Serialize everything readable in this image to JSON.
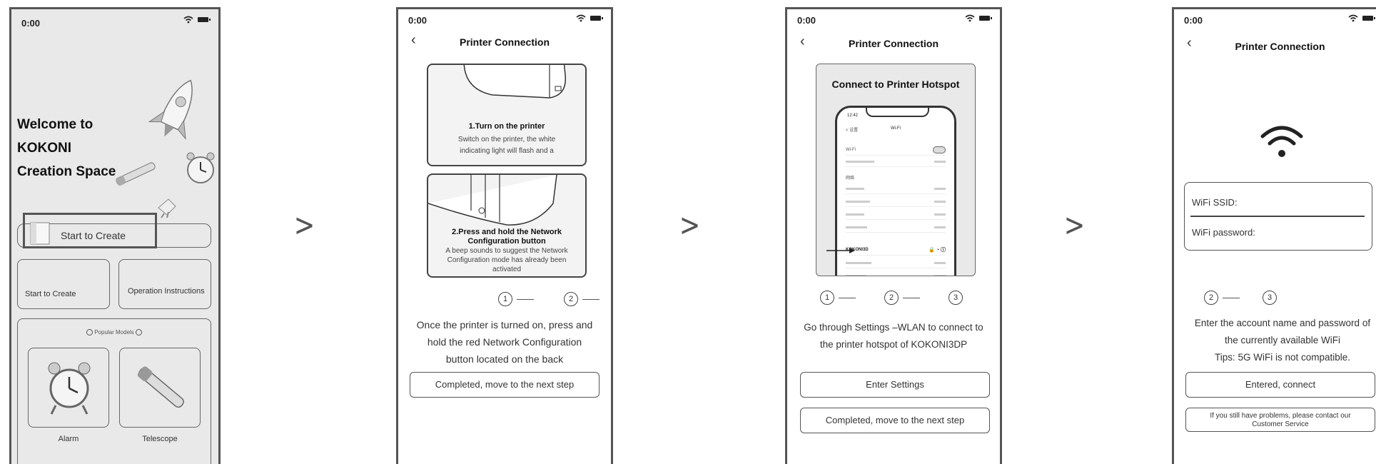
{
  "status_time": "0:00",
  "arrows": [
    ">",
    ">",
    ">"
  ],
  "screen1": {
    "welcome_line1": "Welcome to",
    "welcome_line2": "KOKONI",
    "welcome_line3": "Creation Space",
    "banner_label": "Start to Create",
    "tile_left": "Start to Create",
    "tile_right": "Operation Instructions",
    "popular_label": "Popular Models",
    "model1": "Alarm",
    "model2": "Telescope"
  },
  "screen2": {
    "title": "Printer Connection",
    "step1_title": "1.Turn on the printer",
    "step1_desc_l1": "Switch on the printer, the white",
    "step1_desc_l2": "indicating light will flash and a",
    "step2_title_l1": "2.Press and hold the Network",
    "step2_title_l2": "Configuration button",
    "step2_desc_l1": "A beep sounds to suggest the Network",
    "step2_desc_l2": "Configuration mode has already been",
    "step2_desc_l3": "activated",
    "steps": [
      "1",
      "2"
    ],
    "desc_l1": "Once the printer is turned on, press and",
    "desc_l2": "hold the red Network Configuration",
    "desc_l3": "button located on the back",
    "next_button": "Completed, move to the next step"
  },
  "screen3": {
    "title": "Printer Connection",
    "hotspot_title": "Connect to Printer Hotspot",
    "mock_time": "12:42",
    "mock_back": "< 设置",
    "mock_header": "Wi-Fi",
    "mock_wifi_label": "Wi-Fi",
    "mock_list_label": "网络",
    "mock_network": "KOKONI3D",
    "steps": [
      "1",
      "2",
      "3"
    ],
    "desc_l1": "Go through Settings –WLAN to connect to",
    "desc_l2": "the printer hotspot of KOKONI3DP",
    "settings_button": "Enter Settings",
    "next_button": "Completed, move to the next step"
  },
  "screen4": {
    "title": "Printer Connection",
    "ssid_label": "WiFi SSID:",
    "password_label": "WiFi password:",
    "steps": [
      "2",
      "3"
    ],
    "desc_l1": "Enter the account name and password of",
    "desc_l2": "the currently available WiFi",
    "desc_l3": "Tips: 5G WiFi is not compatible.",
    "connect_button": "Entered, connect",
    "help_l1": "If you still have problems, please contact our",
    "help_l2": "Customer Service"
  },
  "colors": {
    "border": "#555555",
    "background_home": "#e9e9e9"
  },
  "icons": [
    "wifi-icon",
    "battery-icon",
    "back-arrow-icon",
    "rocket-icon",
    "alarm-clock-icon",
    "telescope-icon"
  ]
}
